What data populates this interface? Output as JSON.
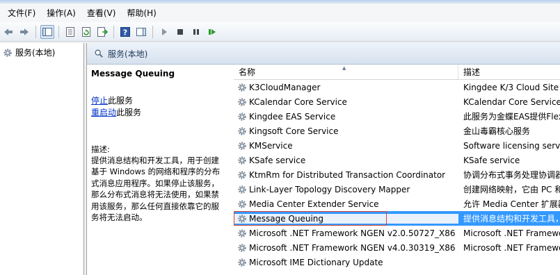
{
  "menu": [
    "文件(F)",
    "操作(A)",
    "查看(V)",
    "帮助(H)"
  ],
  "tree": {
    "root_label": "服务(本地)"
  },
  "main_header": {
    "title": "服务(本地)"
  },
  "detail": {
    "service_name": "Message Queuing",
    "stop_link": "停止",
    "stop_suffix": "此服务",
    "restart_link": "重启动",
    "restart_suffix": "此服务",
    "desc_label": "描述:",
    "desc_lines": [
      "提供消息结构和开发工具，用于创建",
      "基于 Windows 的网络和程序的分布",
      "式消息应用程序。如果停止该服务，",
      "那么分布式消息将无法使用，如果禁",
      "用该服务，那么任何直接依靠它的服",
      "务将无法启动。"
    ]
  },
  "columns": {
    "name": "名称",
    "desc": "描述"
  },
  "services": [
    {
      "name": "K3CloudManager",
      "desc": "Kingdee K/3 Cloud Site"
    },
    {
      "name": "KCalendar Core Service",
      "desc": "KCalendar Core Service"
    },
    {
      "name": "Kingdee EAS Service",
      "desc": "此服务为金蝶EAS提供Flex"
    },
    {
      "name": "Kingsoft Core Service",
      "desc": "金山毒霸核心服务"
    },
    {
      "name": "KMService",
      "desc": "Software licensing servic"
    },
    {
      "name": "KSafe service",
      "desc": "KSafe service"
    },
    {
      "name": "KtmRm for Distributed Transaction Coordinator",
      "desc": "协调分布式事务处理协调器"
    },
    {
      "name": "Link-Layer Topology Discovery Mapper",
      "desc": "创建网络映射，它由 PC 和"
    },
    {
      "name": "Media Center Extender Service",
      "desc": "允许 Media Center 扩展器"
    },
    {
      "name": "Message Queuing",
      "desc": "提供消息结构和开发工具，"
    },
    {
      "name": "Microsoft .NET Framework NGEN v2.0.50727_X86",
      "desc": "Microsoft .NET Framewo"
    },
    {
      "name": "Microsoft .NET Framework NGEN v4.0.30319_X86",
      "desc": "Microsoft .NET Framewo"
    },
    {
      "name": "Microsoft IME Dictionary Update",
      "desc": ""
    }
  ],
  "selected_index": 9,
  "colors": {
    "selection": "#3399ff",
    "link": "#0033cc",
    "highlight_border": "#d9432f"
  }
}
